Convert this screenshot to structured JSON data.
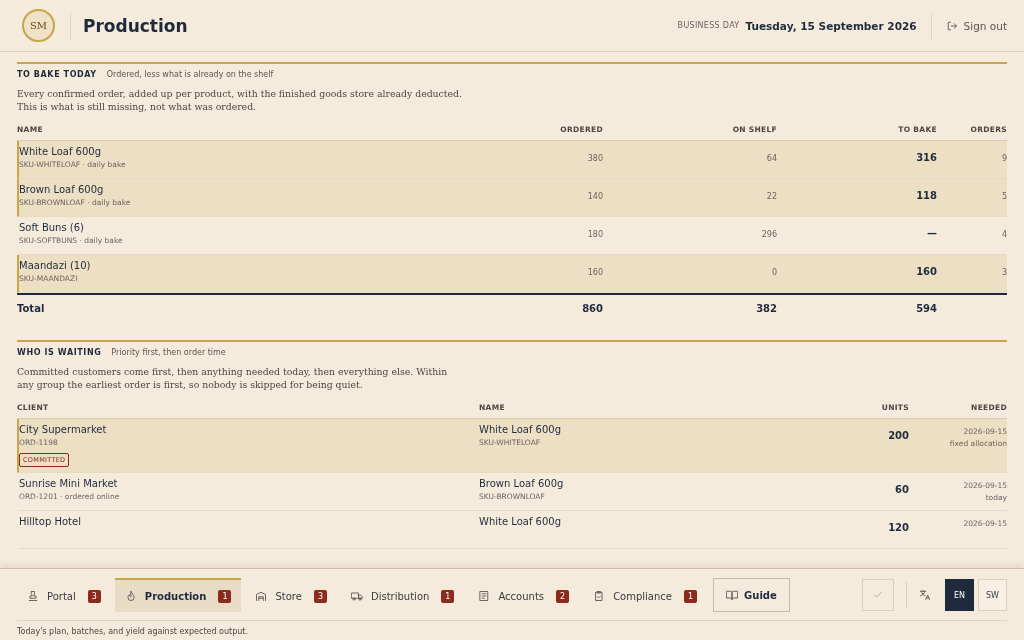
{
  "header": {
    "logo_text": "SM",
    "title": "Production",
    "business_day_label": "BUSINESS DAY",
    "business_day": "Tuesday, 15 September 2026",
    "sign_out": "Sign out"
  },
  "bake_section": {
    "title": "TO BAKE TODAY",
    "subtitle": "Ordered, less what is already on the shelf",
    "description": "Every confirmed order, added up per product, with the finished goods store already deducted. This is what is still missing, not what was ordered.",
    "columns": [
      "NAME",
      "ORDERED",
      "ON SHELF",
      "TO BAKE",
      "ORDERS"
    ],
    "rows": [
      {
        "name": "White Loaf 600g",
        "meta": "SKU-WHITELOAF · daily bake",
        "ordered": "380",
        "on_shelf": "64",
        "to_bake": "316",
        "orders": "9",
        "flagged": true
      },
      {
        "name": "Brown Loaf 600g",
        "meta": "SKU-BROWNLOAF · daily bake",
        "ordered": "140",
        "on_shelf": "22",
        "to_bake": "118",
        "orders": "5",
        "flagged": true
      },
      {
        "name": "Soft Buns (6)",
        "meta": "SKU-SOFTBUNS · daily bake",
        "ordered": "180",
        "on_shelf": "296",
        "to_bake": "—",
        "orders": "4",
        "flagged": false
      },
      {
        "name": "Maandazi (10)",
        "meta": "SKU-MAANDAZI",
        "ordered": "160",
        "on_shelf": "0",
        "to_bake": "160",
        "orders": "3",
        "flagged": true
      }
    ],
    "total": {
      "label": "Total",
      "ordered": "860",
      "on_shelf": "382",
      "to_bake": "594"
    }
  },
  "waiting_section": {
    "title": "WHO IS WAITING",
    "subtitle": "Priority first, then order time",
    "description": "Committed customers come first, then anything needed today, then everything else. Within any group the earliest order is first, so nobody is skipped for being quiet.",
    "columns": [
      "CLIENT",
      "NAME",
      "UNITS",
      "NEEDED"
    ],
    "rows": [
      {
        "client": "City Supermarket",
        "order": "ORD-1198",
        "badge": "COMMITTED",
        "product": "White Loaf 600g",
        "sku": "SKU-WHITELOAF",
        "units": "200",
        "date": "2026-09-15",
        "note": "fixed allocation",
        "flagged": true
      },
      {
        "client": "Sunrise Mini Market",
        "order": "ORD-1201 · ordered online",
        "product": "Brown Loaf 600g",
        "sku": "SKU-BROWNLOAF",
        "units": "60",
        "date": "2026-09-15",
        "note": "today",
        "flagged": false
      },
      {
        "client": "Hilltop Hotel",
        "product": "White Loaf 600g",
        "units": "120",
        "date": "2026-09-15",
        "flagged": false
      }
    ]
  },
  "nav": {
    "tabs": [
      {
        "label": "Portal",
        "count": "3",
        "selected": false
      },
      {
        "label": "Production",
        "count": "1",
        "selected": true
      },
      {
        "label": "Store",
        "count": "3",
        "selected": false
      },
      {
        "label": "Distribution",
        "count": "1",
        "selected": false
      },
      {
        "label": "Accounts",
        "count": "2",
        "selected": false
      },
      {
        "label": "Compliance",
        "count": "1",
        "selected": false
      }
    ],
    "guide": "Guide",
    "languages": [
      {
        "label": "EN",
        "selected": true
      },
      {
        "label": "SW",
        "selected": false
      }
    ],
    "hint": "Today's plan, batches, and yield against expected output."
  }
}
